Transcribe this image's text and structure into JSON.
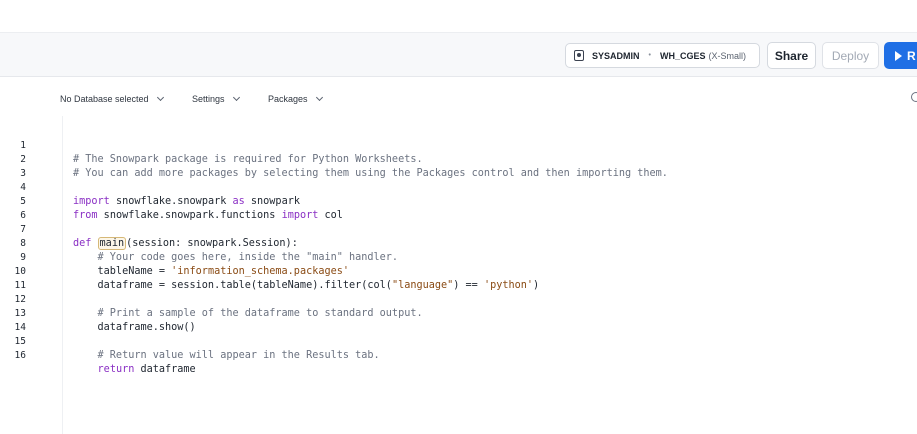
{
  "header": {
    "role": "SYSADMIN",
    "separator": "•",
    "warehouse": "WH_CGES",
    "warehouse_size": "(X-Small)",
    "share_label": "Share",
    "deploy_label": "Deploy",
    "run_label": "R"
  },
  "toolbar": {
    "database_label": "No Database selected",
    "settings_label": "Settings",
    "packages_label": "Packages"
  },
  "editor": {
    "line_numbers": [
      "1",
      "2",
      "3",
      "4",
      "5",
      "6",
      "7",
      "8",
      "9",
      "10",
      "11",
      "12",
      "13",
      "14",
      "15",
      "16"
    ],
    "l1": "# The Snowpark package is required for Python Worksheets.",
    "l2": "# You can add more packages by selecting them using the Packages control and then importing them.",
    "l4": {
      "kw1": "import",
      "mod": " snowflake.snowpark ",
      "kw2": "as",
      "alias": " snowpark"
    },
    "l5": {
      "kw1": "from",
      "mod": " snowflake.snowpark.functions ",
      "kw2": "import",
      "name": " col"
    },
    "l7": {
      "kw": "def",
      "fn": "main",
      "rest": "(session: snowpark.Session):"
    },
    "l8": "    # Your code goes here, inside the \"main\" handler.",
    "l9": {
      "pre": "    tableName = ",
      "str": "'information_schema.packages'"
    },
    "l10": {
      "pre": "    dataframe = session.table(tableName).filter(col(",
      "str1": "\"language\"",
      "mid": ") == ",
      "str2": "'python'",
      "post": ")"
    },
    "l12": "    # Print a sample of the dataframe to standard output.",
    "l13": "    dataframe.show()",
    "l15": "    # Return value will appear in the Results tab.",
    "l16": {
      "pre": "    ",
      "kw": "return",
      "rest": " dataframe"
    }
  }
}
